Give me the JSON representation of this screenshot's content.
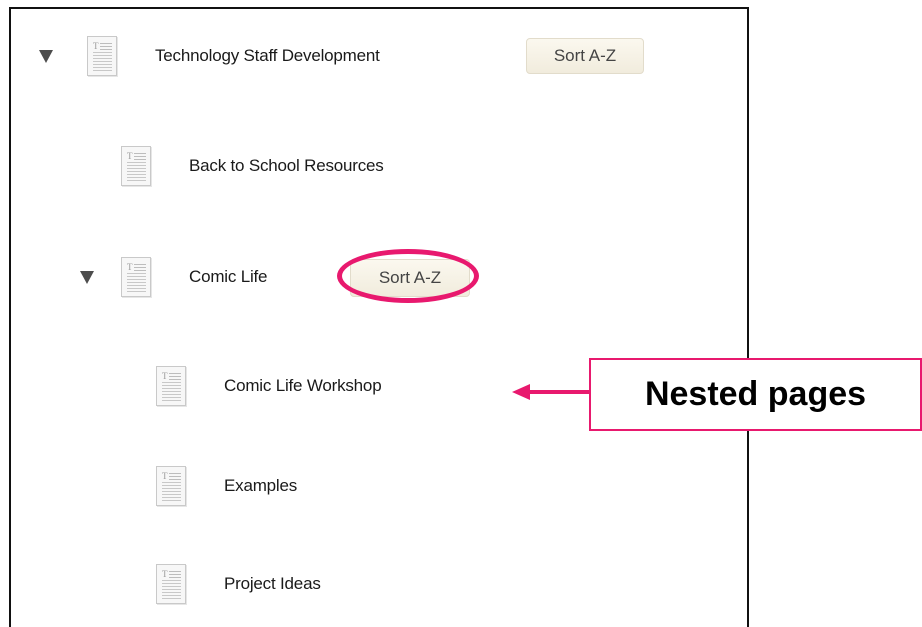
{
  "tree": {
    "sort_label": "Sort A-Z",
    "items": [
      {
        "label": "Technology Staff Development",
        "expanded": true,
        "has_sort": true
      },
      {
        "label": "Back to School Resources"
      },
      {
        "label": "Comic Life",
        "expanded": true,
        "has_sort": true
      },
      {
        "label": "Comic Life Workshop"
      },
      {
        "label": "Examples"
      },
      {
        "label": "Project Ideas"
      }
    ]
  },
  "annotation": {
    "callout_text": "Nested pages",
    "color": "#e8196e"
  },
  "icons": {
    "page": "page-icon",
    "expand": "expanded-triangle-icon"
  }
}
